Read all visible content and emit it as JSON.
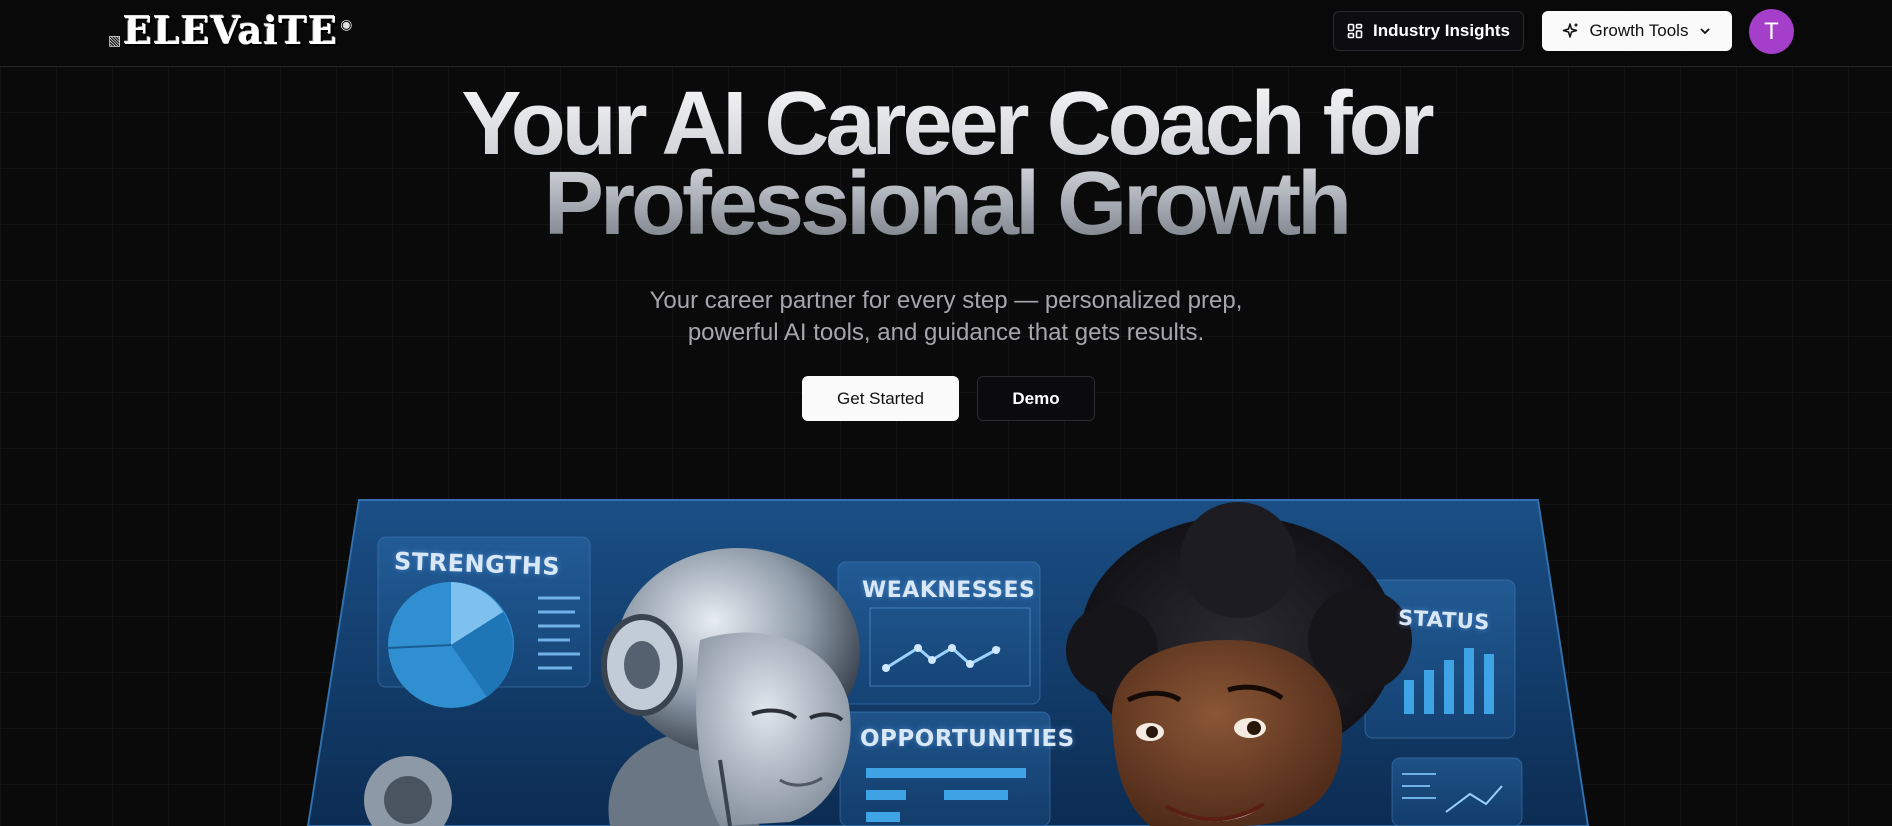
{
  "header": {
    "logo_text": "ELEVaiTE",
    "nav": {
      "insights_label": "Industry Insights",
      "insights_icon": "dashboard-grid-icon",
      "growth_label": "Growth Tools",
      "growth_icon": "sparkles-icon",
      "growth_chevron": "chevron-down-icon"
    },
    "avatar_initial": "T",
    "avatar_color": "#a53fc9"
  },
  "hero": {
    "title_line1": "Your AI Career Coach for",
    "title_line2": "Professional Growth",
    "subtitle_line1": "Your career partner for every step — personalized prep,",
    "subtitle_line2": "powerful AI tools, and guidance that gets results.",
    "primary_button": "Get Started",
    "secondary_button": "Demo"
  },
  "illustration": {
    "panel_labels": {
      "strengths": "STRENGTHS",
      "weaknesses": "WEAKNESSES",
      "opportunities": "OPPORTUNITIES",
      "status": "STATUS"
    }
  },
  "colors": {
    "background": "#0a0a0b",
    "accent": "#a53fc9",
    "panel_blue": "#1a4f86"
  }
}
